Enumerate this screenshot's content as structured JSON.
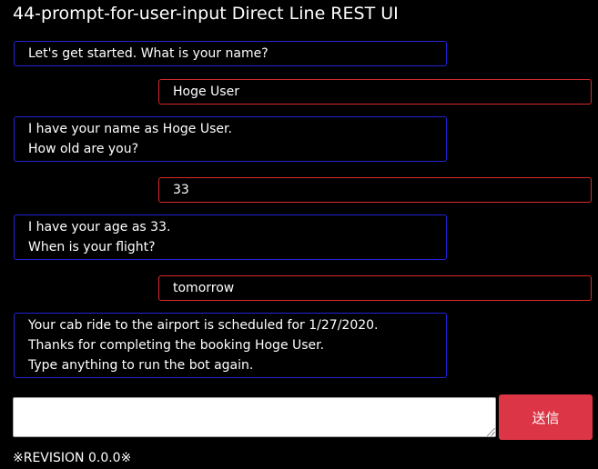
{
  "header": {
    "title": "44-prompt-for-user-input Direct Line REST UI"
  },
  "conversation": {
    "messages": [
      {
        "from": "bot",
        "lines": [
          "Let's get started. What is your name?"
        ]
      },
      {
        "from": "user",
        "lines": [
          "Hoge User"
        ]
      },
      {
        "from": "bot",
        "lines": [
          "I have your name as Hoge User.",
          "How old are you?"
        ]
      },
      {
        "from": "user",
        "lines": [
          "33"
        ]
      },
      {
        "from": "bot",
        "lines": [
          "I have your age as 33.",
          "When is your flight?"
        ]
      },
      {
        "from": "user",
        "lines": [
          "tomorrow"
        ]
      },
      {
        "from": "bot",
        "lines": [
          "Your cab ride to the airport is scheduled for 1/27/2020.",
          "Thanks for completing the booking Hoge User.",
          "Type anything to run the bot again."
        ]
      }
    ]
  },
  "composer": {
    "input_value": "",
    "send_label": "送信"
  },
  "footer": {
    "revision": "※REVISION 0.0.0※"
  },
  "colors": {
    "background": "#000000",
    "bot_border": "#2323d6",
    "user_border": "#d62a2a",
    "send_button": "#dc3545"
  }
}
